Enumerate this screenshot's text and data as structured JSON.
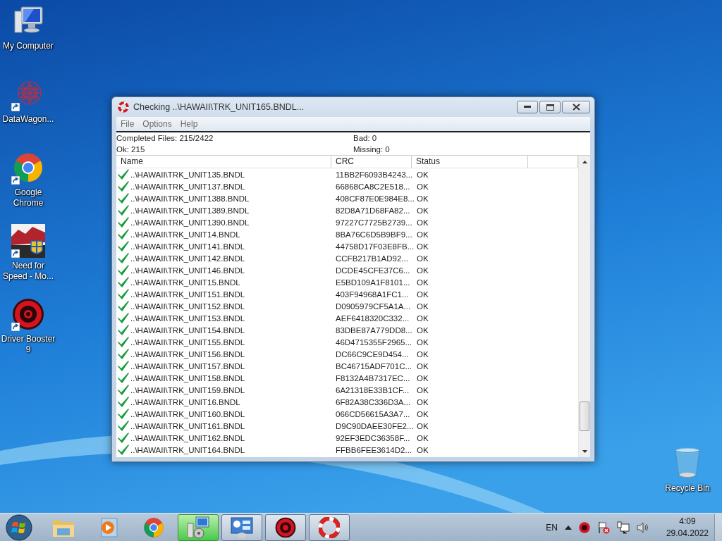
{
  "desktop_icons": [
    {
      "label": "My Computer",
      "kind": "computer",
      "shortcut": false
    },
    {
      "label": "DataWagon...",
      "kind": "web",
      "shortcut": true
    },
    {
      "label": "Google Chrome",
      "kind": "chrome",
      "shortcut": true
    },
    {
      "label": "Need for Speed - Mo...",
      "kind": "game",
      "shortcut": true
    },
    {
      "label": "Driver Booster 9",
      "kind": "booster",
      "shortcut": true
    }
  ],
  "recycle_bin": {
    "label": "Recycle Bin"
  },
  "window": {
    "title": "Checking ..\\HAWAII\\TRK_UNIT165.BNDL...",
    "menu": [
      "File",
      "Options",
      "Help"
    ],
    "summary": {
      "completed": "Completed Files: 215/2422",
      "ok": "Ok: 215",
      "bad": "Bad: 0",
      "missing": "Missing: 0"
    },
    "columns": [
      "Name",
      "CRC",
      "Status"
    ],
    "rows": [
      {
        "name": "..\\HAWAII\\TRK_UNIT135.BNDL",
        "crc": "11BB2F6093B4243...",
        "status": "OK",
        "kind": "ok"
      },
      {
        "name": "..\\HAWAII\\TRK_UNIT137.BNDL",
        "crc": "66868CA8C2E518...",
        "status": "OK",
        "kind": "ok"
      },
      {
        "name": "..\\HAWAII\\TRK_UNIT1388.BNDL",
        "crc": "408CF87E0E984E8...",
        "status": "OK",
        "kind": "ok"
      },
      {
        "name": "..\\HAWAII\\TRK_UNIT1389.BNDL",
        "crc": "82D8A71D68FA82...",
        "status": "OK",
        "kind": "ok"
      },
      {
        "name": "..\\HAWAII\\TRK_UNIT1390.BNDL",
        "crc": "97227C7725B2739...",
        "status": "OK",
        "kind": "ok"
      },
      {
        "name": "..\\HAWAII\\TRK_UNIT14.BNDL",
        "crc": "8BA76C6D5B9BF9...",
        "status": "OK",
        "kind": "ok"
      },
      {
        "name": "..\\HAWAII\\TRK_UNIT141.BNDL",
        "crc": "44758D17F03E8FB...",
        "status": "OK",
        "kind": "ok"
      },
      {
        "name": "..\\HAWAII\\TRK_UNIT142.BNDL",
        "crc": "CCFB217B1AD92...",
        "status": "OK",
        "kind": "ok"
      },
      {
        "name": "..\\HAWAII\\TRK_UNIT146.BNDL",
        "crc": "DCDE45CFE37C6...",
        "status": "OK",
        "kind": "ok"
      },
      {
        "name": "..\\HAWAII\\TRK_UNIT15.BNDL",
        "crc": "E5BD109A1F8101...",
        "status": "OK",
        "kind": "ok"
      },
      {
        "name": "..\\HAWAII\\TRK_UNIT151.BNDL",
        "crc": "403F94968A1FC1...",
        "status": "OK",
        "kind": "ok"
      },
      {
        "name": "..\\HAWAII\\TRK_UNIT152.BNDL",
        "crc": "D0905979CF5A1A...",
        "status": "OK",
        "kind": "ok"
      },
      {
        "name": "..\\HAWAII\\TRK_UNIT153.BNDL",
        "crc": "AEF6418320C332...",
        "status": "OK",
        "kind": "ok"
      },
      {
        "name": "..\\HAWAII\\TRK_UNIT154.BNDL",
        "crc": "83DBE87A779DD8...",
        "status": "OK",
        "kind": "ok"
      },
      {
        "name": "..\\HAWAII\\TRK_UNIT155.BNDL",
        "crc": "46D4715355F2965...",
        "status": "OK",
        "kind": "ok"
      },
      {
        "name": "..\\HAWAII\\TRK_UNIT156.BNDL",
        "crc": "DC66C9CE9D454...",
        "status": "OK",
        "kind": "ok"
      },
      {
        "name": "..\\HAWAII\\TRK_UNIT157.BNDL",
        "crc": "BC46715ADF701C...",
        "status": "OK",
        "kind": "ok"
      },
      {
        "name": "..\\HAWAII\\TRK_UNIT158.BNDL",
        "crc": "F8132A4B7317EC...",
        "status": "OK",
        "kind": "ok"
      },
      {
        "name": "..\\HAWAII\\TRK_UNIT159.BNDL",
        "crc": "6A21318E33B1CF...",
        "status": "OK",
        "kind": "ok"
      },
      {
        "name": "..\\HAWAII\\TRK_UNIT16.BNDL",
        "crc": "6F82A38C336D3A...",
        "status": "OK",
        "kind": "ok"
      },
      {
        "name": "..\\HAWAII\\TRK_UNIT160.BNDL",
        "crc": "066CD56615A3A7...",
        "status": "OK",
        "kind": "ok"
      },
      {
        "name": "..\\HAWAII\\TRK_UNIT161.BNDL",
        "crc": "D9C90DAEE30FE2...",
        "status": "OK",
        "kind": "ok"
      },
      {
        "name": "..\\HAWAII\\TRK_UNIT162.BNDL",
        "crc": "92EF3EDC36358F...",
        "status": "OK",
        "kind": "ok"
      },
      {
        "name": "..\\HAWAII\\TRK_UNIT164.BNDL",
        "crc": "FFBB6FEE3614D2...",
        "status": "OK",
        "kind": "ok"
      }
    ]
  },
  "taskbar": {
    "apps": [
      {
        "kind": "explorer",
        "open": false,
        "selected": false
      },
      {
        "kind": "media",
        "open": false,
        "selected": false
      },
      {
        "kind": "chrome",
        "open": false,
        "selected": false
      },
      {
        "kind": "installer",
        "open": true,
        "selected": true
      },
      {
        "kind": "panel",
        "open": true,
        "selected": false
      },
      {
        "kind": "booster",
        "open": true,
        "selected": false
      },
      {
        "kind": "lifebuoy",
        "open": true,
        "selected": false
      }
    ],
    "language": "EN",
    "time": "4:09",
    "date": "29.04.2022"
  }
}
